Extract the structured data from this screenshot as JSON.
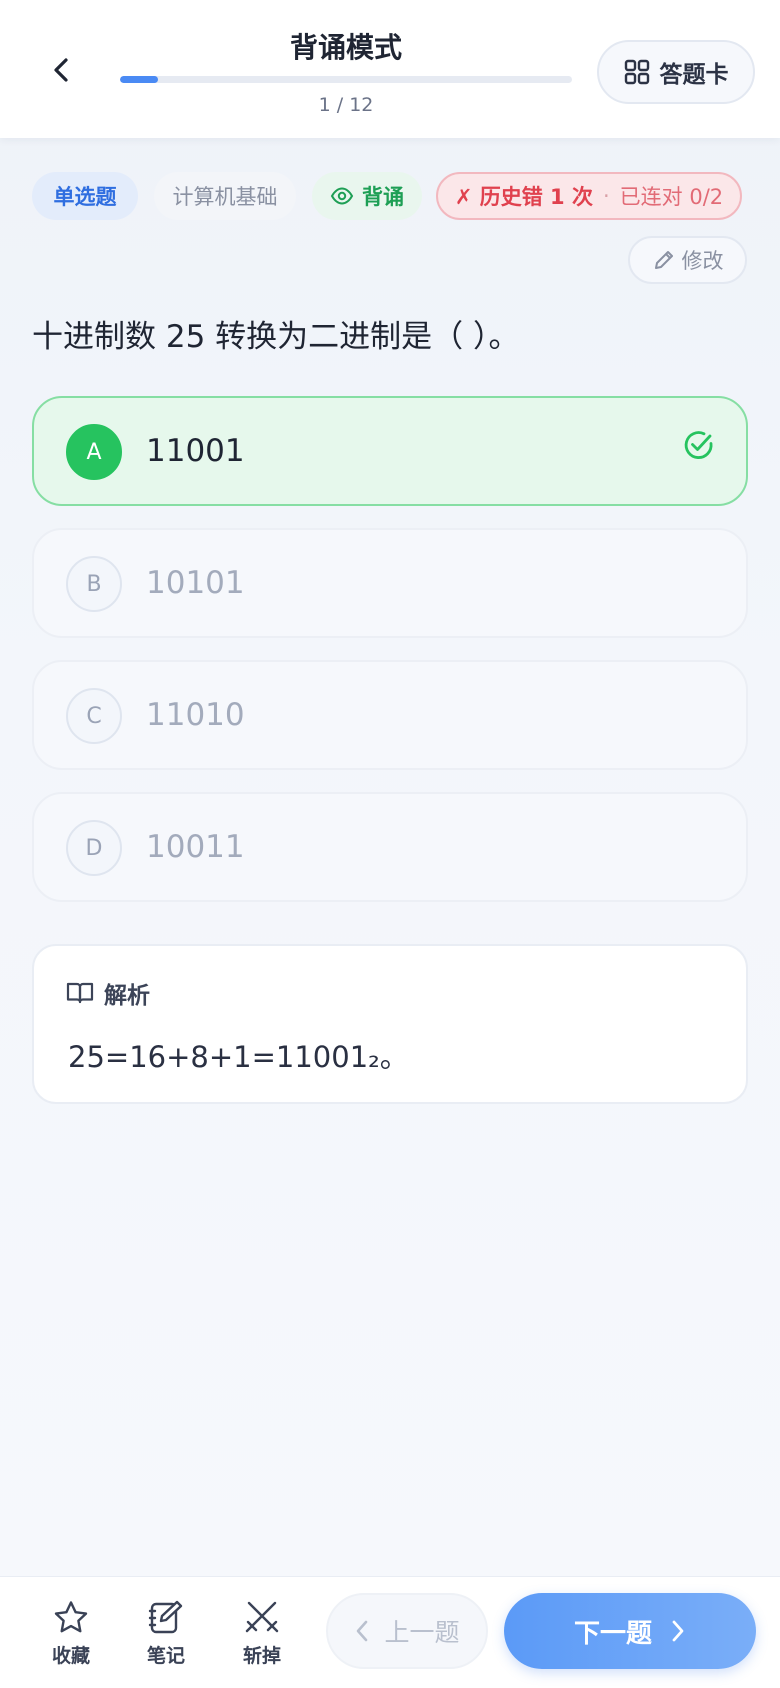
{
  "header": {
    "title": "背诵模式",
    "progress_text": "1 / 12",
    "progress_fraction": 0.0833,
    "answer_card_label": "答题卡"
  },
  "tags": {
    "type": "单选题",
    "subject": "计算机基础",
    "mode": "背诵",
    "history_error": "✗ 历史错 1 次",
    "separator": "·",
    "streak": "已连对 0/2"
  },
  "edit_label": "修改",
  "question": "十进制数 25 转换为二进制是（ ）。",
  "options": [
    {
      "letter": "A",
      "text": "11001",
      "correct": true
    },
    {
      "letter": "B",
      "text": "10101",
      "correct": false
    },
    {
      "letter": "C",
      "text": "11010",
      "correct": false
    },
    {
      "letter": "D",
      "text": "10011",
      "correct": false
    }
  ],
  "analysis": {
    "title": "解析",
    "body": "25=16+8+1=11001₂。"
  },
  "bottom": {
    "favorite": "收藏",
    "note": "笔记",
    "remove": "斩掉",
    "prev": "上一题",
    "next": "下一题"
  },
  "colors": {
    "accent": "#4a8af4",
    "correct": "#26c35f",
    "error": "#e0414e"
  }
}
